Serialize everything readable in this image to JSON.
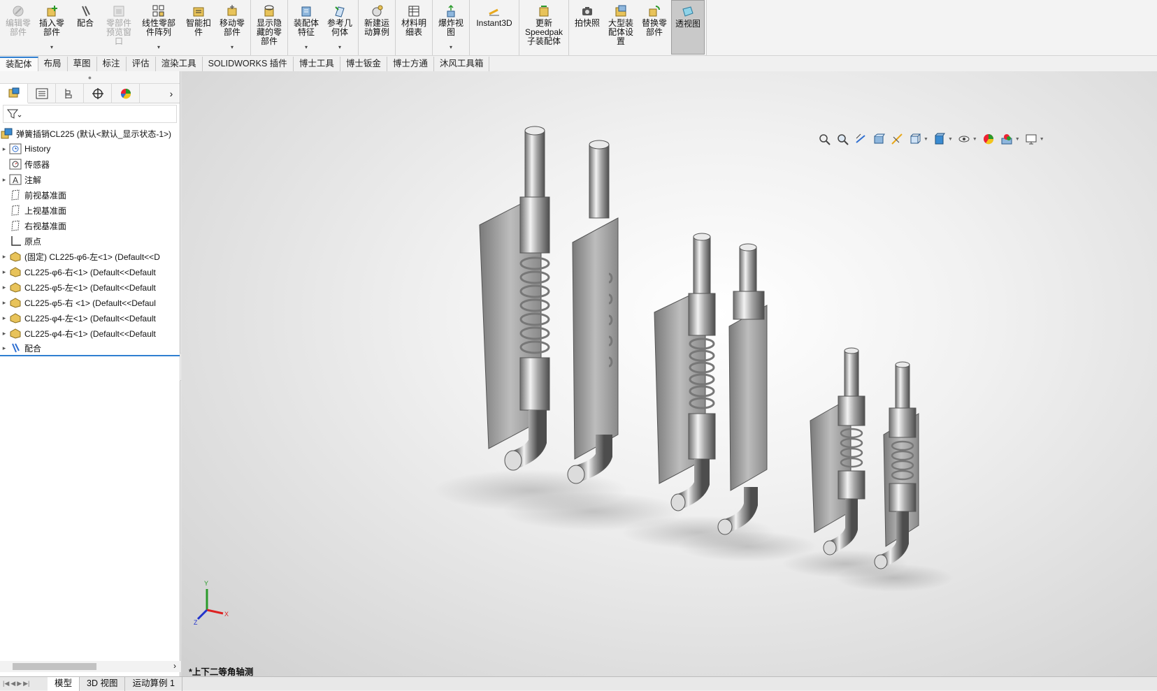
{
  "ribbon": {
    "buttons": [
      {
        "label": "编辑零\n部件",
        "icon": "edit-component-icon",
        "disabled": true
      },
      {
        "label": "插入零\n部件",
        "icon": "insert-component-icon",
        "dropdown": true
      },
      {
        "label": "配合",
        "icon": "mate-icon"
      },
      {
        "label": "零部件\n预览窗\n口",
        "icon": "component-preview-icon",
        "disabled": true
      },
      {
        "label": "线性零部\n件阵列",
        "icon": "linear-pattern-icon",
        "dropdown": true
      },
      {
        "label": "智能扣\n件",
        "icon": "smart-fastener-icon"
      },
      {
        "label": "移动零\n部件",
        "icon": "move-component-icon",
        "dropdown": true
      },
      {
        "label": "显示隐\n藏的零\n部件",
        "icon": "show-hidden-icon"
      },
      {
        "label": "装配体\n特征",
        "icon": "assembly-feature-icon",
        "dropdown": true
      },
      {
        "label": "参考几\n何体",
        "icon": "reference-geometry-icon",
        "dropdown": true
      },
      {
        "label": "新建运\n动算例",
        "icon": "new-motion-study-icon"
      },
      {
        "label": "材料明\n细表",
        "icon": "bom-icon"
      },
      {
        "label": "爆炸视\n图",
        "icon": "exploded-view-icon",
        "dropdown": true
      },
      {
        "label": "Instant3D",
        "icon": "instant3d-icon"
      },
      {
        "label": "更新\nSpeedpak\n子装配体",
        "icon": "speedpak-icon"
      },
      {
        "label": "拍快照",
        "icon": "snapshot-icon"
      },
      {
        "label": "大型装\n配体设\n置",
        "icon": "large-assembly-icon"
      },
      {
        "label": "替换零\n部件",
        "icon": "replace-component-icon"
      },
      {
        "label": "透视图",
        "icon": "perspective-icon",
        "active": true
      }
    ]
  },
  "tabs": [
    "装配体",
    "布局",
    "草图",
    "标注",
    "评估",
    "渲染工具",
    "SOLIDWORKS 插件",
    "博士工具",
    "博士钣金",
    "博士方通",
    "沐风工具箱"
  ],
  "tree": {
    "root": "弹簧插销CL225  (默认<默认_显示状态-1>)",
    "items": [
      {
        "label": "History",
        "icon": "history-icon",
        "twist": true
      },
      {
        "label": "传感器",
        "icon": "sensor-icon",
        "twist": false
      },
      {
        "label": "注解",
        "icon": "annotation-icon",
        "twist": true
      },
      {
        "label": "前视基准面",
        "icon": "plane-icon",
        "twist": false
      },
      {
        "label": "上视基准面",
        "icon": "plane-icon",
        "twist": false
      },
      {
        "label": "右视基准面",
        "icon": "plane-icon",
        "twist": false
      },
      {
        "label": "原点",
        "icon": "origin-icon",
        "twist": false
      },
      {
        "label": "(固定) CL225-φ6-左<1> (Default<<D",
        "icon": "part-icon",
        "twist": true
      },
      {
        "label": "CL225-φ6-右<1> (Default<<Default",
        "icon": "part-icon",
        "twist": true
      },
      {
        "label": "CL225-φ5-左<1> (Default<<Default",
        "icon": "part-icon",
        "twist": true
      },
      {
        "label": "CL225-φ5-右 <1> (Default<<Defaul",
        "icon": "part-icon",
        "twist": true
      },
      {
        "label": "CL225-φ4-左<1> (Default<<Default",
        "icon": "part-icon",
        "twist": true
      },
      {
        "label": "CL225-φ4-右<1> (Default<<Default",
        "icon": "part-icon",
        "twist": true
      },
      {
        "label": "配合",
        "icon": "mates-folder-icon",
        "twist": true
      }
    ]
  },
  "viewport": {
    "view_name": "*上下二等角轴测",
    "triad": {
      "x": "X",
      "y": "Y",
      "z": "Z"
    }
  },
  "bottom_tabs": [
    "模型",
    "3D 视图",
    "运动算例 1"
  ]
}
